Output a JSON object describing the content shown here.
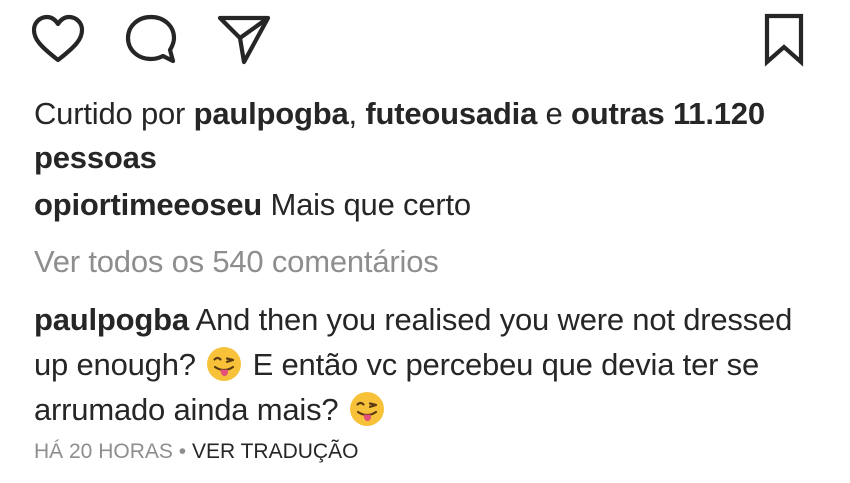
{
  "actions": {
    "like_icon": "heart-outline",
    "comment_icon": "speech-bubble-outline",
    "share_icon": "paper-plane-outline",
    "save_icon": "bookmark-outline"
  },
  "likes": {
    "prefix": "Curtido por",
    "user1": "paulpogba",
    "separator": ",",
    "user2": "futeousadia",
    "conjunction": "e",
    "others": "outras 11.120 pessoas"
  },
  "caption": {
    "username": "opiortimeeoseu",
    "text": "Mais que certo"
  },
  "view_all_comments": "Ver todos os 540 comentários",
  "comment": {
    "username": "paulpogba",
    "text_part1": "And then you realised you were not dressed up enough?",
    "emoji1": "winking-face-with-tongue",
    "text_part2": "E então vc percebeu que devia ter se arrumado ainda mais?",
    "emoji2": "winking-face-with-tongue"
  },
  "meta": {
    "time": "HÁ 20 HORAS",
    "dot": "•",
    "translate": "VER TRADUÇÃO"
  },
  "colors": {
    "text": "#262626",
    "muted": "#8e8e8e",
    "emoji_face": "#F7C23A",
    "emoji_tongue": "#E4507A"
  }
}
